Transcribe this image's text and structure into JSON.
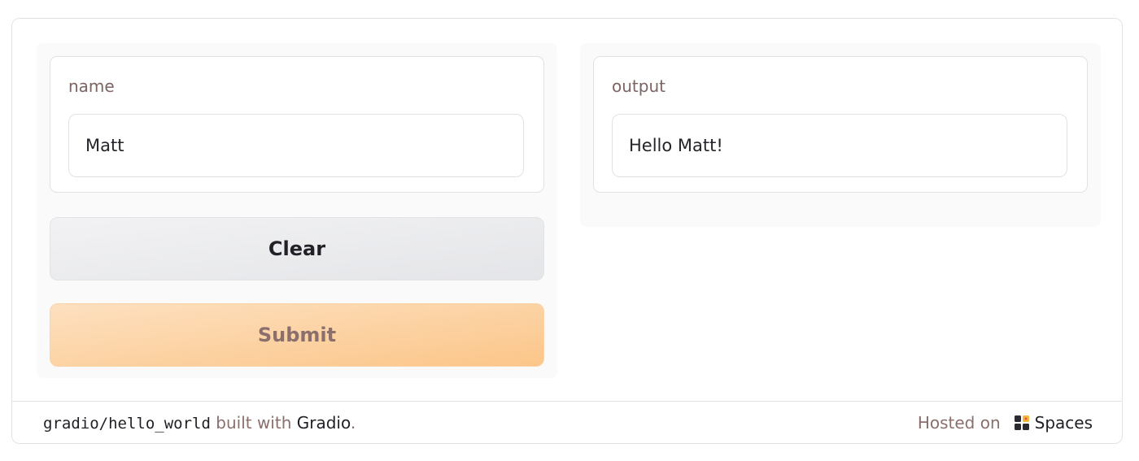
{
  "input_block": {
    "label": "name",
    "value": "Matt"
  },
  "output_block": {
    "label": "output",
    "value": "Hello Matt!"
  },
  "buttons": {
    "clear_label": "Clear",
    "submit_label": "Submit"
  },
  "footer": {
    "repo": "gradio/hello_world",
    "built_with_text": "built with",
    "gradio_link": "Gradio",
    "period": ".",
    "hosted_on_text": "Hosted on",
    "spaces_link": "Spaces",
    "spaces_icon": "spaces-icon"
  },
  "colors": {
    "label": "#7c6463",
    "submit_bg": "#fcc689",
    "clear_bg": "#e4e5e8",
    "muted_text": "#8a6f6d"
  }
}
